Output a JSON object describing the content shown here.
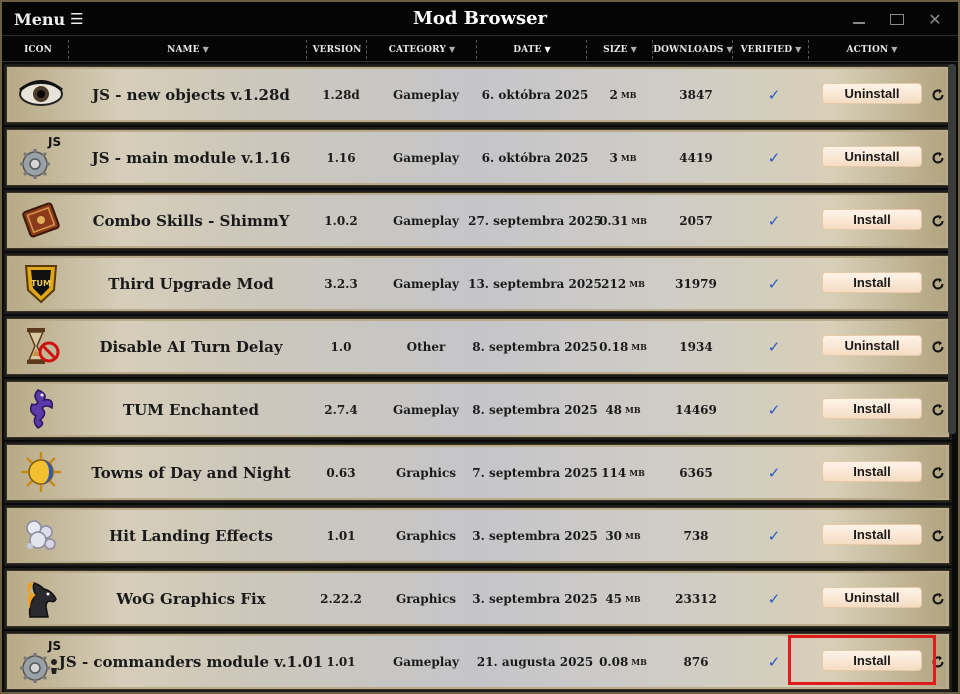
{
  "window": {
    "title": "Mod Browser",
    "menu_label": "Menu"
  },
  "columns": {
    "icon": "ICON",
    "name": "NAME",
    "version": "VERSION",
    "category": "CATEGORY",
    "date": "DATE",
    "size": "SIZE",
    "downloads": "DOWNLOADS",
    "verified": "VERIFIED",
    "action": "ACTION"
  },
  "rows": [
    {
      "icon": "eye-icon",
      "name": "JS - new objects v.1.28d",
      "version": "1.28d",
      "category": "Gameplay",
      "date": "6. októbra 2025",
      "size": "2",
      "unit": "MB",
      "downloads": "3847",
      "verified": "✓",
      "action": "Uninstall"
    },
    {
      "icon": "gear-js-icon",
      "name": "JS - main module v.1.16",
      "version": "1.16",
      "category": "Gameplay",
      "date": "6. októbra 2025",
      "size": "3",
      "unit": "MB",
      "downloads": "4419",
      "verified": "✓",
      "action": "Uninstall"
    },
    {
      "icon": "spellbook-icon",
      "name": "Combo Skills - ShimmY",
      "version": "1.0.2",
      "category": "Gameplay",
      "date": "27. septembra 2025",
      "size": "0.31",
      "unit": "MB",
      "downloads": "2057",
      "verified": "✓",
      "action": "Install"
    },
    {
      "icon": "tum-shield-icon",
      "name": "Third Upgrade Mod",
      "version": "3.2.3",
      "category": "Gameplay",
      "date": "13. septembra 2025",
      "size": "212",
      "unit": "MB",
      "downloads": "31979",
      "verified": "✓",
      "action": "Install"
    },
    {
      "icon": "hourglass-no-icon",
      "name": "Disable AI Turn Delay",
      "version": "1.0",
      "category": "Other",
      "date": "8. septembra 2025",
      "size": "0.18",
      "unit": "MB",
      "downloads": "1934",
      "verified": "✓",
      "action": "Uninstall"
    },
    {
      "icon": "dragon-icon",
      "name": "TUM Enchanted",
      "version": "2.7.4",
      "category": "Gameplay",
      "date": "8. septembra 2025",
      "size": "48",
      "unit": "MB",
      "downloads": "14469",
      "verified": "✓",
      "action": "Install"
    },
    {
      "icon": "sun-moon-icon",
      "name": "Towns of Day and Night",
      "version": "0.63",
      "category": "Graphics",
      "date": "7. septembra 2025",
      "size": "114",
      "unit": "MB",
      "downloads": "6365",
      "verified": "✓",
      "action": "Install"
    },
    {
      "icon": "sparkle-impact-icon",
      "name": "Hit Landing Effects",
      "version": "1.01",
      "category": "Graphics",
      "date": "3. septembra 2025",
      "size": "30",
      "unit": "MB",
      "downloads": "738",
      "verified": "✓",
      "action": "Install"
    },
    {
      "icon": "horse-icon",
      "name": "WoG Graphics Fix",
      "version": "2.22.2",
      "category": "Graphics",
      "date": "3. septembra 2025",
      "size": "45",
      "unit": "MB",
      "downloads": "23312",
      "verified": "✓",
      "action": "Uninstall"
    },
    {
      "icon": "gear-js-commander-icon",
      "name": "JS - commanders module v.1.01",
      "version": "1.01",
      "category": "Gameplay",
      "date": "21. augusta 2025",
      "size": "0.08",
      "unit": "MB",
      "downloads": "876",
      "verified": "✓",
      "action": "Install"
    }
  ],
  "icon_text": {
    "js": "JS",
    "tum": "TUM"
  },
  "colors": {
    "verified_check": "#2b59c3",
    "highlight": "#e01b1b"
  }
}
